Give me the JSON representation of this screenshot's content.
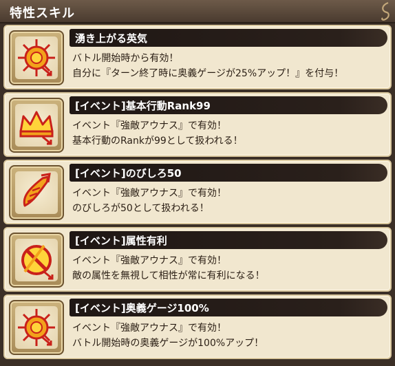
{
  "panel": {
    "title": "特性スキル",
    "ornament_icon": "scroll-curl-ornament"
  },
  "skills": [
    {
      "icon": "sunburst-arrow-icon",
      "name": "湧き上がる英気",
      "lines": [
        "バトル開始時から有効！",
        "自分に『ターン終了時に奥義ゲージが25%アップ！』を付与！"
      ]
    },
    {
      "icon": "crown-arrow-icon",
      "name": "[イベント]基本行動Rank99",
      "lines": [
        "イベント『強敵アウナス』で有効！",
        "基本行動のRankが99として扱われる！"
      ]
    },
    {
      "icon": "spiral-horn-icon",
      "name": "[イベント]のびしろ50",
      "lines": [
        "イベント『強敵アウナス』で有効！",
        "のびしろが50として扱われる！"
      ]
    },
    {
      "icon": "crossed-circle-arrow-icon",
      "name": "[イベント]属性有利",
      "lines": [
        "イベント『強敵アウナス』で有効！",
        "敵の属性を無視して相性が常に有利になる！"
      ]
    },
    {
      "icon": "sunburst-arrow-icon",
      "name": "[イベント]奥義ゲージ100%",
      "lines": [
        "イベント『強敵アウナス』で有効！",
        "バトル開始時の奥義ゲージが100%アップ！"
      ]
    }
  ],
  "colors": {
    "icon_red": "#c9211a",
    "icon_orange": "#f2a21b",
    "icon_yellow": "#ffd43a"
  }
}
